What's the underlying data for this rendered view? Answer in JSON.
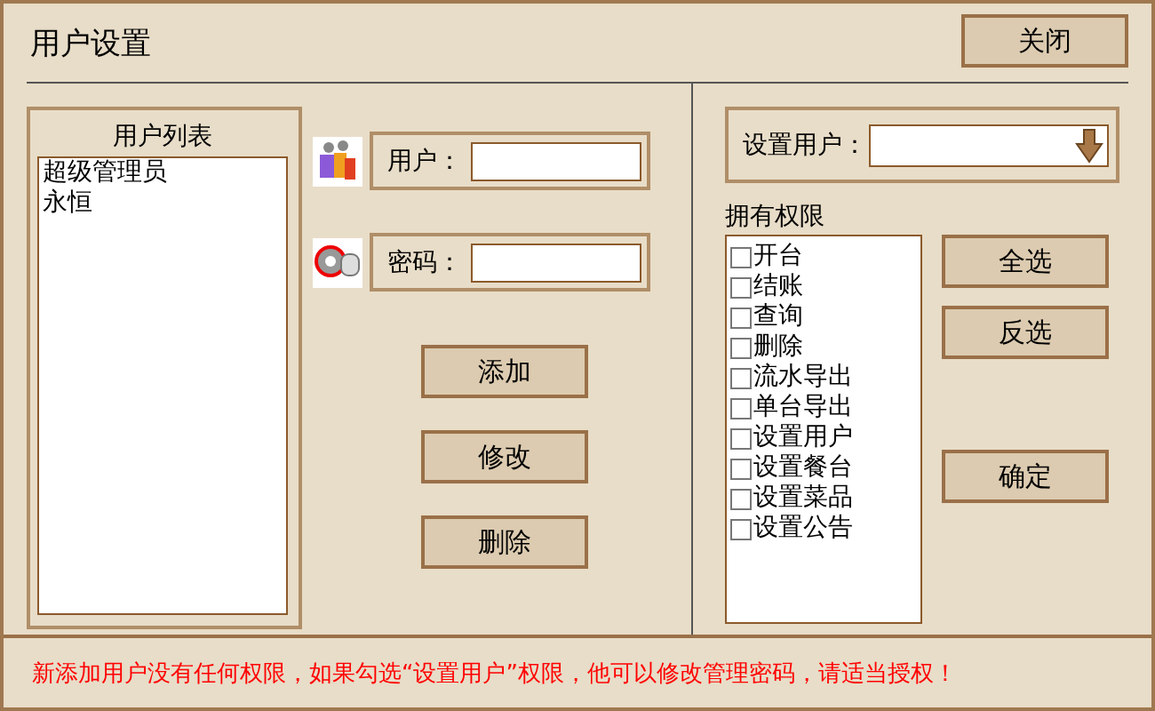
{
  "window": {
    "title": "用户设置"
  },
  "close_button": "关闭",
  "user_list": {
    "title": "用户列表",
    "items": [
      {
        "label": "超级管理员",
        "selected": false
      },
      {
        "label": "永恒",
        "selected": false
      }
    ]
  },
  "fields": [
    {
      "kind": "user",
      "label": "用户："
    },
    {
      "kind": "password",
      "label": "密码："
    }
  ],
  "actions": [
    "添加",
    "修改",
    "删除"
  ],
  "set_user": {
    "label": "设置用户："
  },
  "permissions": {
    "title": "拥有权限",
    "items": [
      {
        "label": "开台",
        "checked": false
      },
      {
        "label": "结账",
        "checked": false
      },
      {
        "label": "查询",
        "checked": false
      },
      {
        "label": "删除",
        "checked": false
      },
      {
        "label": "流水导出",
        "checked": false
      },
      {
        "label": "单台导出",
        "checked": false
      },
      {
        "label": "设置用户",
        "checked": false
      },
      {
        "label": "设置餐台",
        "checked": false
      },
      {
        "label": "设置菜品",
        "checked": false
      },
      {
        "label": "设置公告",
        "checked": false
      }
    ]
  },
  "permission_buttons": [
    "全选",
    "反选"
  ],
  "confirm_button": "确定",
  "notice": "新添加用户没有任何权限，如果勾选“设置用户”权限，他可以修改管理密码，请适当授权！"
}
